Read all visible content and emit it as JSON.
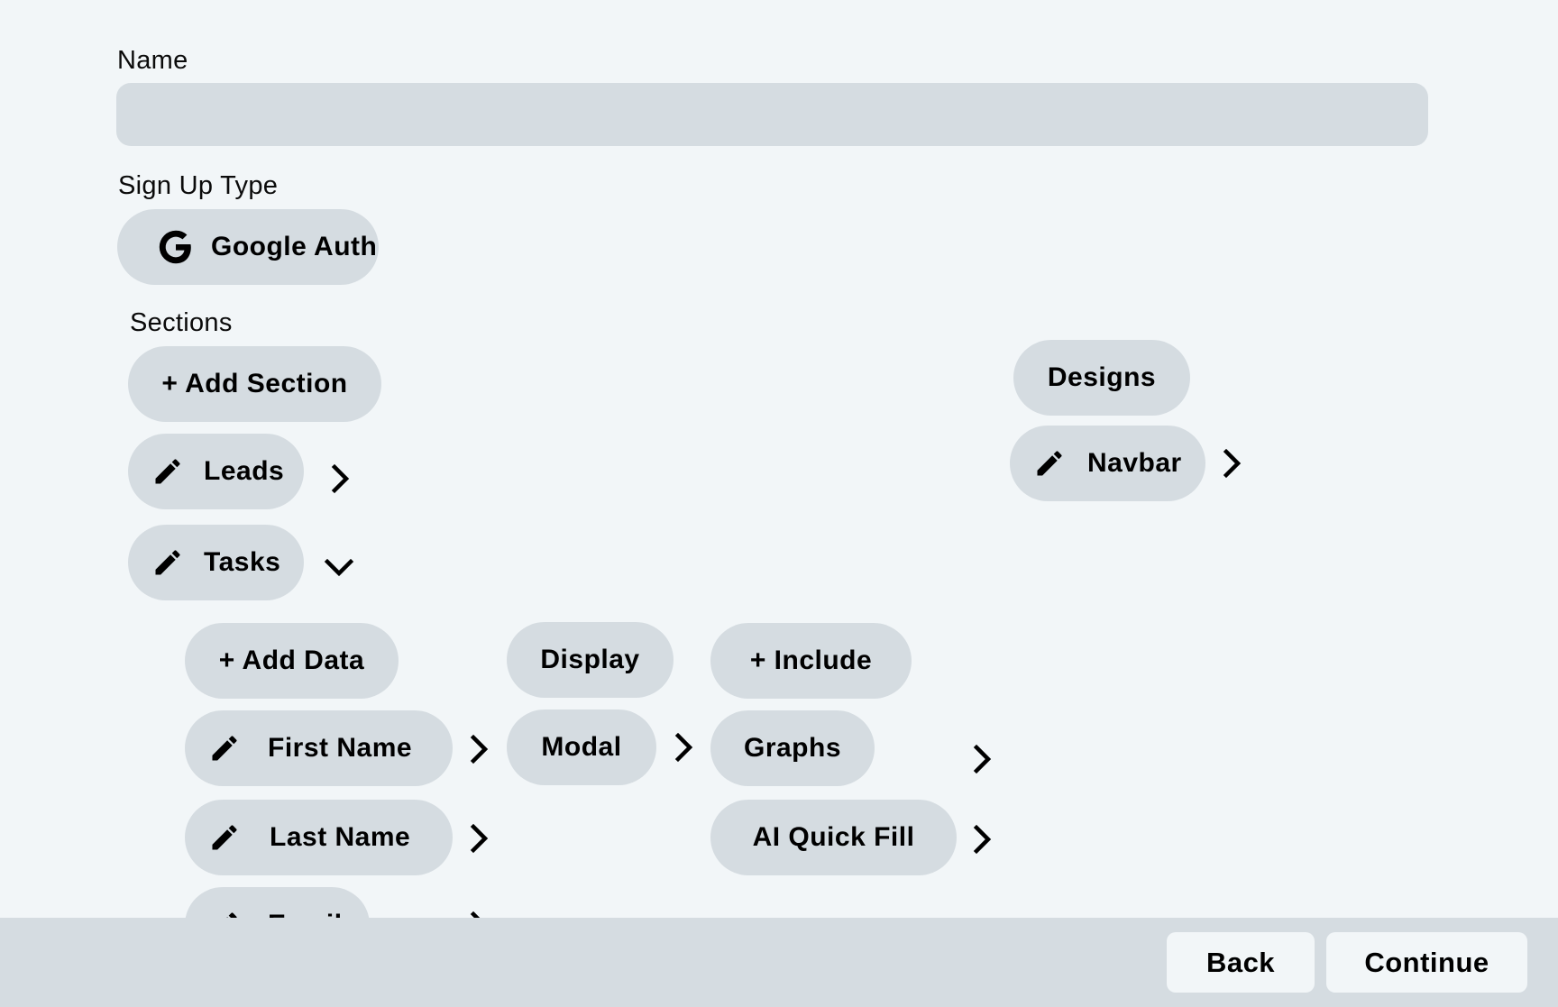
{
  "form": {
    "name_label": "Name",
    "name_value": "",
    "name_placeholder": "",
    "signup_type_label": "Sign Up Type",
    "signup_type": {
      "label": "Google Auth",
      "icon": "google-icon"
    },
    "sections_label": "Sections"
  },
  "sections": {
    "add_label": "+ Add Section",
    "items": [
      {
        "label": "Leads",
        "icon": "pencil-icon",
        "state": "collapsed"
      },
      {
        "label": "Tasks",
        "icon": "pencil-icon",
        "state": "expanded"
      }
    ]
  },
  "tasks_data": {
    "add_label": "+ Add Data",
    "items": [
      {
        "label": "First Name",
        "icon": "pencil-icon"
      },
      {
        "label": "Last Name",
        "icon": "pencil-icon"
      },
      {
        "label": "Email",
        "icon": "pencil-icon"
      }
    ]
  },
  "display": {
    "header_label": "Display",
    "items": [
      {
        "label": "Modal"
      }
    ]
  },
  "include": {
    "add_label": "+ Include",
    "items": [
      {
        "label": "Graphs"
      },
      {
        "label": "AI Quick Fill"
      }
    ]
  },
  "designs": {
    "header_label": "Designs",
    "items": [
      {
        "label": "Navbar",
        "icon": "pencil-icon"
      }
    ]
  },
  "footer": {
    "back_label": "Back",
    "continue_label": "Continue"
  }
}
